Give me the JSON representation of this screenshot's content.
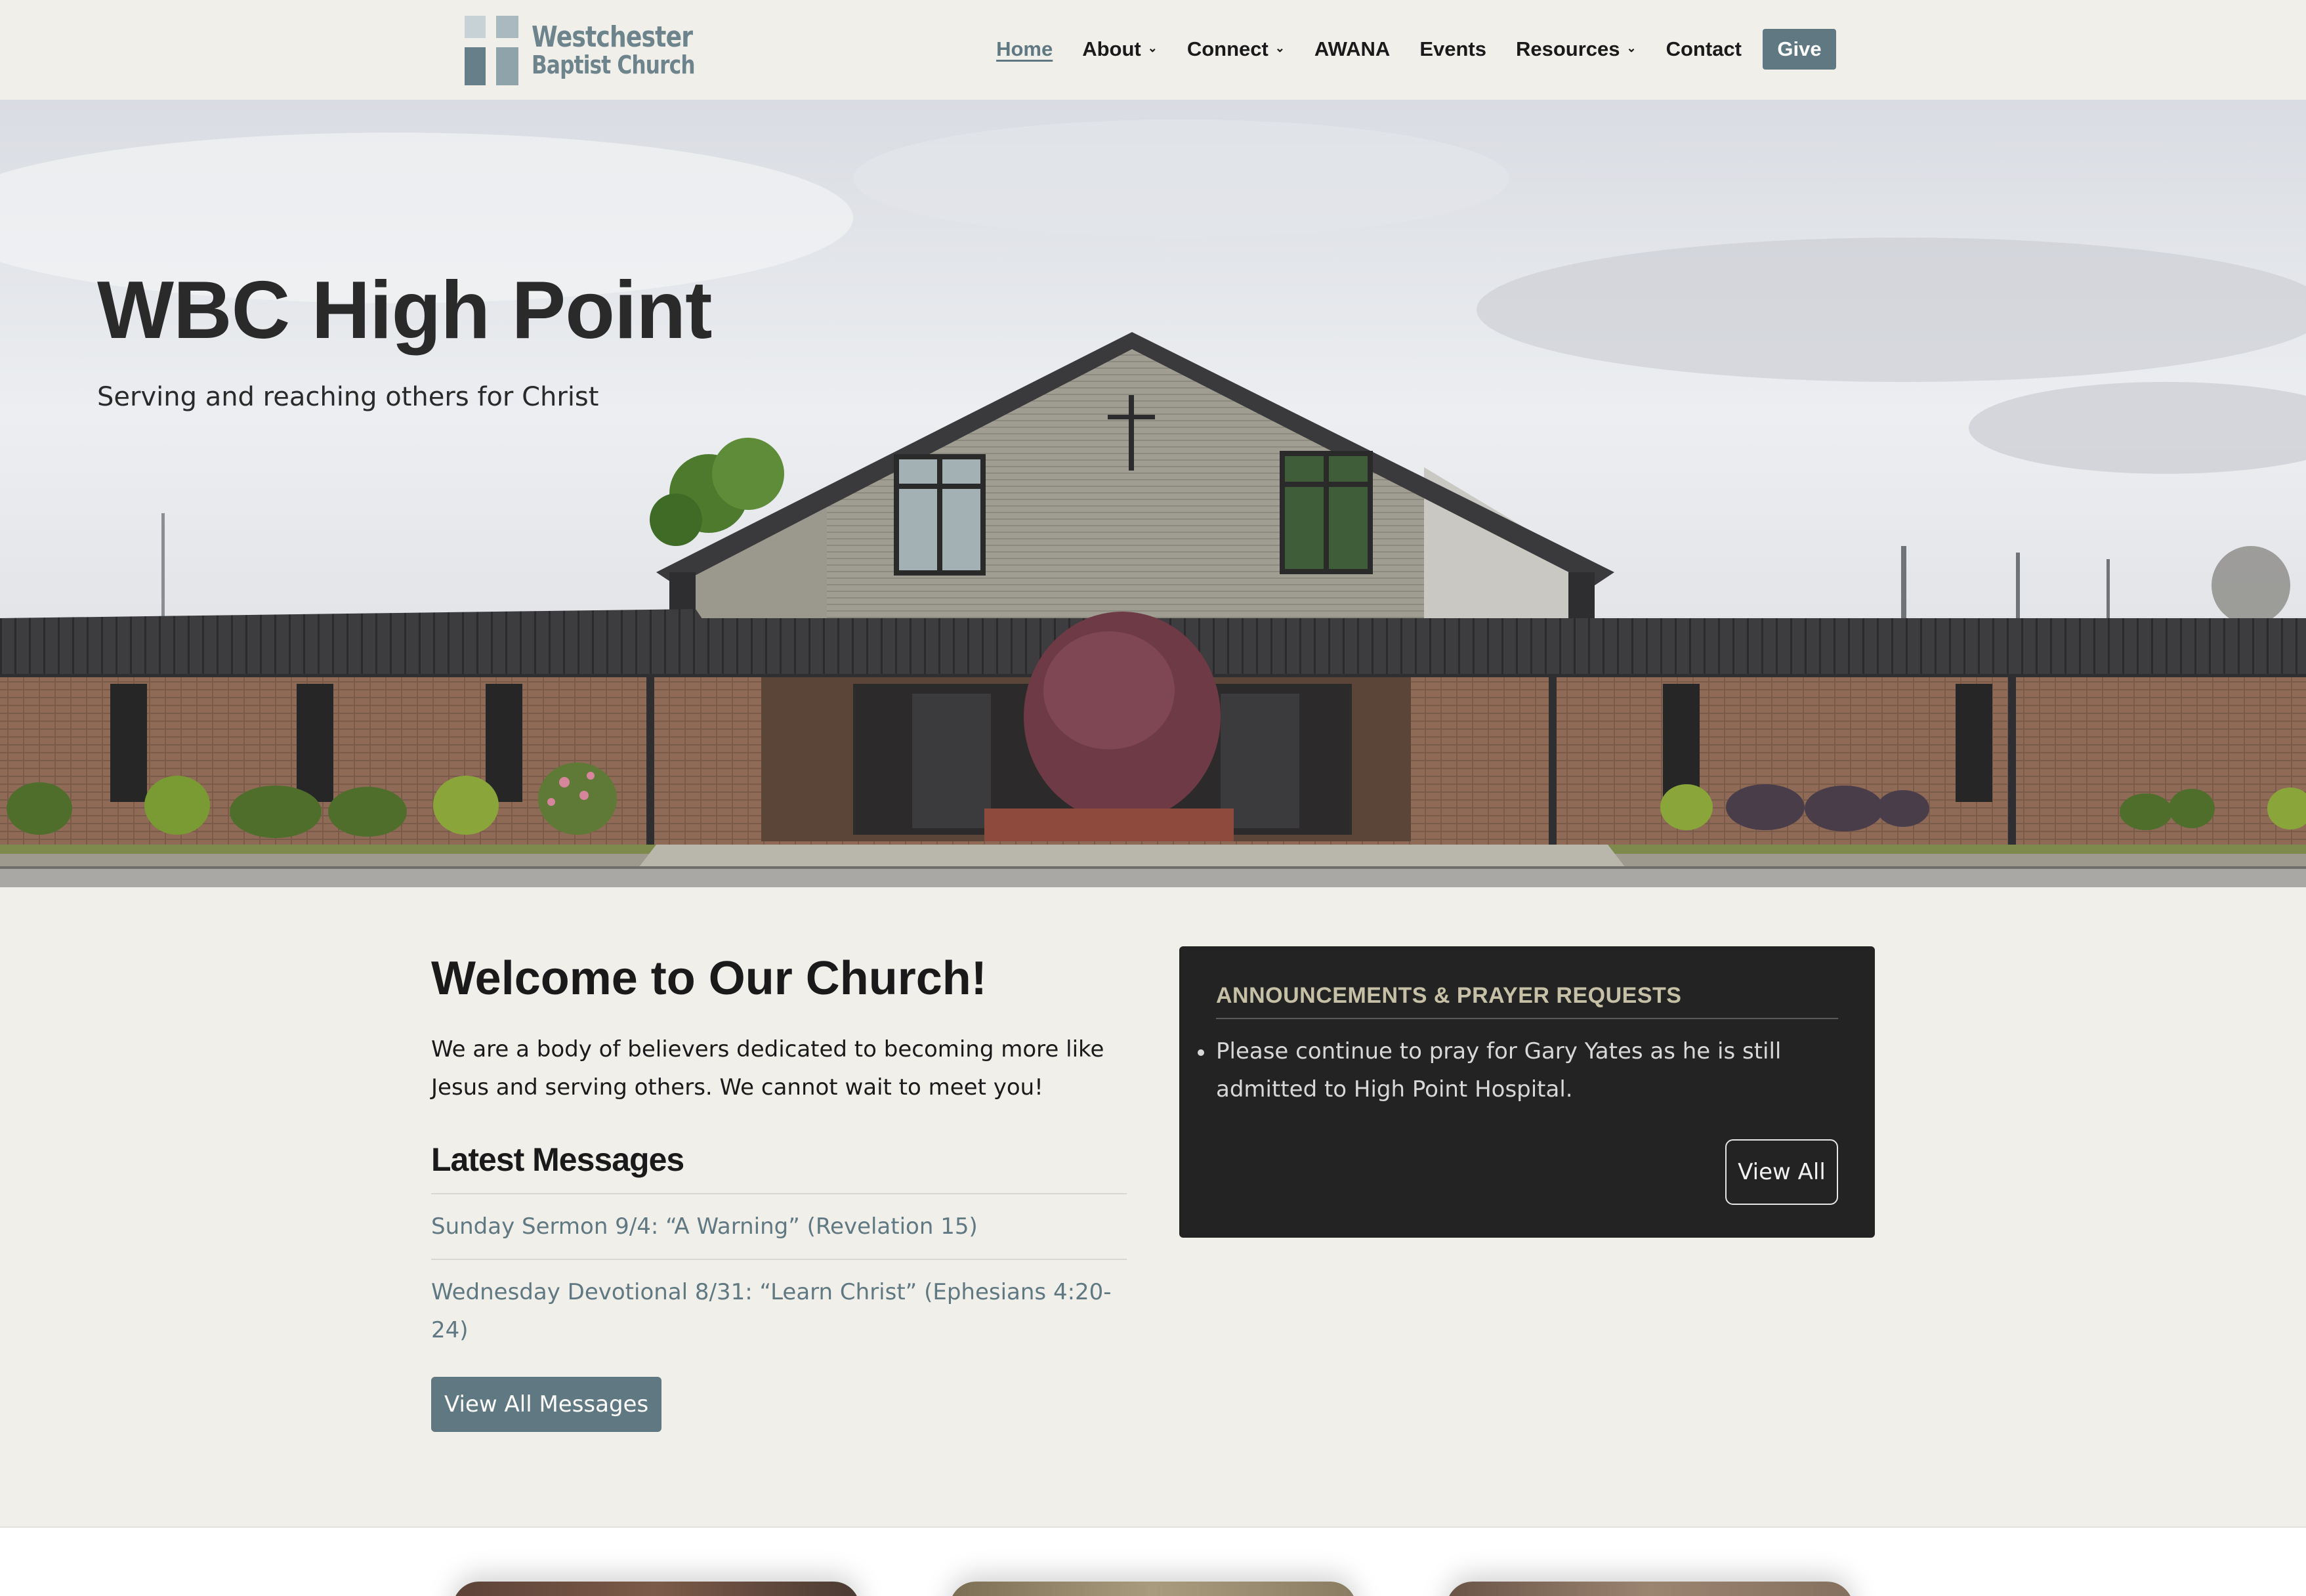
{
  "site": {
    "logo_line1": "Westchester",
    "logo_line2": "Baptist Church"
  },
  "nav": {
    "items": [
      {
        "label": "Home",
        "active": true,
        "dropdown": false
      },
      {
        "label": "About",
        "active": false,
        "dropdown": true
      },
      {
        "label": "Connect",
        "active": false,
        "dropdown": true
      },
      {
        "label": "AWANA",
        "active": false,
        "dropdown": false
      },
      {
        "label": "Events",
        "active": false,
        "dropdown": false
      },
      {
        "label": "Resources",
        "active": false,
        "dropdown": true
      },
      {
        "label": "Contact",
        "active": false,
        "dropdown": false
      }
    ],
    "give_label": "Give",
    "dropdown_icon": "chevron-down-icon"
  },
  "hero": {
    "title": "WBC High Point",
    "subtitle": "Serving and reaching others for Christ"
  },
  "welcome": {
    "title": "Welcome to Our Church!",
    "text": "We are a body of believers dedicated to becoming more like Jesus and serving others. We cannot wait to meet you!"
  },
  "messages": {
    "title": "Latest Messages",
    "items": [
      "Sunday Sermon 9/4: “A Warning” (Revelation 15)",
      "Wednesday Devotional 8/31: “Learn Christ” (Ephesians 4:20-24)"
    ],
    "view_all_label": "View All Messages"
  },
  "announcements": {
    "title": "ANNOUNCEMENTS & PRAYER REQUESTS",
    "items": [
      "Please continue to pray for Gary Yates as he is still admitted to High Point Hospital."
    ],
    "view_all_label": "View All"
  },
  "colors": {
    "page_bg": "#f0efea",
    "accent": "#5f7882",
    "panel_bg": "#232323",
    "panel_heading": "#c5c0a6"
  }
}
